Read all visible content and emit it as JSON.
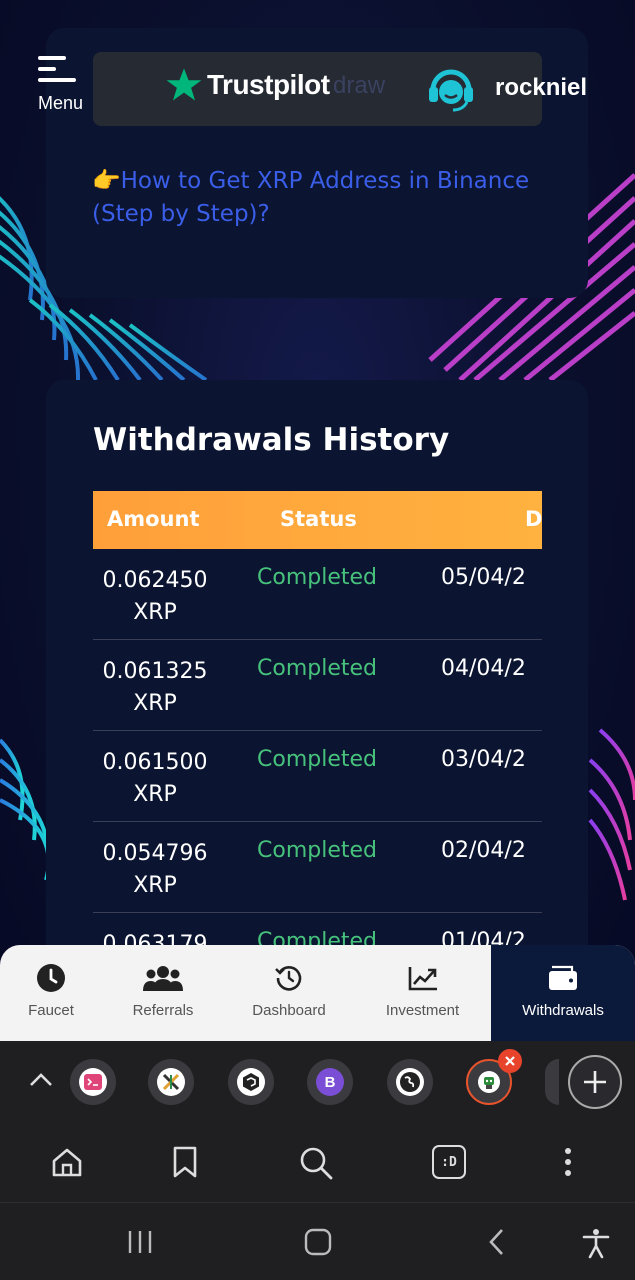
{
  "header": {
    "menu_label": "Menu",
    "banner_ghost_text": "draw",
    "trustpilot_label": "Trustpilot",
    "support_brand": "rockniel"
  },
  "guide_link": {
    "emoji": "👉",
    "text": "How to Get XRP Address in Binance (Step by Step)?"
  },
  "history": {
    "title": "Withdrawals History",
    "columns": [
      "Amount",
      "Status",
      "D"
    ],
    "rows": [
      {
        "amount": "0.062450",
        "unit": "XRP",
        "status": "Completed",
        "date": "05/04/2"
      },
      {
        "amount": "0.061325",
        "unit": "XRP",
        "status": "Completed",
        "date": "04/04/2"
      },
      {
        "amount": "0.061500",
        "unit": "XRP",
        "status": "Completed",
        "date": "03/04/2"
      },
      {
        "amount": "0.054796",
        "unit": "XRP",
        "status": "Completed",
        "date": "02/04/2"
      },
      {
        "amount": "0.063179",
        "unit": "",
        "status": "Completed",
        "date": "01/04/2"
      }
    ]
  },
  "app_nav": {
    "items": [
      {
        "label": "Faucet",
        "icon": "clock-icon"
      },
      {
        "label": "Referrals",
        "icon": "users-icon"
      },
      {
        "label": "Dashboard",
        "icon": "history-icon"
      },
      {
        "label": "Investment",
        "icon": "chart-up-icon"
      },
      {
        "label": "Withdrawals",
        "icon": "wallet-icon"
      }
    ],
    "active": "Withdrawals"
  },
  "browser_toolbar": {
    "tab_manager_label": ":D"
  },
  "colors": {
    "accent_orange": "#ffa93d",
    "status_green": "#47c27c",
    "link_blue": "#3a5ee8",
    "trustpilot_green": "#00b67a",
    "support_cyan": "#1fc3d6",
    "active_tab_ring": "#e8542c"
  }
}
